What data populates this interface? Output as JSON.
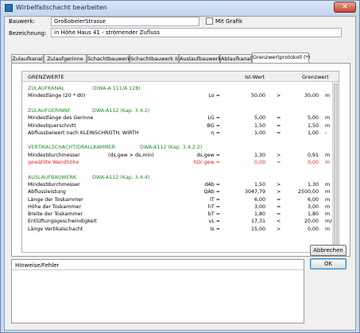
{
  "window": {
    "title": "Wirbelfallschacht bearbeiten",
    "close_glyph": "✕"
  },
  "form": {
    "bauwerk_label": "Bauwerk:",
    "bauwerk_value": "GroßobelerStrasse",
    "mit_grafik_label": "Mit Grafik",
    "bezeichnung_label": "Bezeichnung:",
    "bezeichnung_value": "in Höhe Haus 41 - strömender Zufluss"
  },
  "tabs": [
    "Zulaufkanal",
    "Zulaufgerinne",
    "Schachtbauwerk I",
    "Schachtbauwerk II",
    "Auslaufbauwerk",
    "Ablaufkanal",
    "Grenzwertprotokoll (*)"
  ],
  "grid": {
    "headers": {
      "name": "GRENZWERTE",
      "ist": "Ist-Wert",
      "grenz": "Grenzwert"
    },
    "rows": [
      {
        "type": "section",
        "name": "ZULAUFKANAL",
        "ref": "(DWA-A 111/A 128)"
      },
      {
        "type": "data",
        "name": "Mindestlänge (20 * d0)",
        "sym": "Lo =",
        "val": "50,00",
        "op": ">",
        "limit": "30,00",
        "unit": "m"
      },
      {
        "type": "blank"
      },
      {
        "type": "section",
        "name": "ZULAUFGERINNE",
        "ref": "DWA-A112 (Kap. 3.4.2)"
      },
      {
        "type": "data",
        "name": "Mindestlänge  des Gerinne",
        "sym": "LG =",
        "val": "5,00",
        "op": "=",
        "limit": "5,00",
        "unit": "m"
      },
      {
        "type": "data",
        "name": "Mindestquerschnitt",
        "sym": "BG =",
        "val": "1,50",
        "op": "=",
        "limit": "1,50",
        "unit": "m"
      },
      {
        "type": "data",
        "name": "Abflussbeiwert nach KLEINSCHROTH, WIRTH",
        "sym": "η =",
        "val": "1,00",
        "op": "=",
        "limit": "1,00",
        "unit": "-"
      },
      {
        "type": "blank"
      },
      {
        "type": "section",
        "name": "VERTIKALSCHACHT/DRALLKAMMER",
        "ref": "DWA-A112 (Kap. 3.4.2.2)"
      },
      {
        "type": "data",
        "name": "Mindestdurchmesser",
        "mid": "(ds,gew > ds,min)",
        "sym": "ds,gew =",
        "val": "1,30",
        "op": ">",
        "limit": "0,91",
        "unit": "m"
      },
      {
        "type": "red",
        "name": "gewählte Wandhöhe",
        "sym": "hDr,gew =",
        "val": "0,00",
        "op": "=",
        "limit": "0,00",
        "unit": "m"
      },
      {
        "type": "blank"
      },
      {
        "type": "section",
        "name": "AUSLAUFBAUWERK",
        "ref": "DWA-A112 (Kap. 3.4.4)"
      },
      {
        "type": "data",
        "name": "Mindestdurchmesser",
        "sym": "dAb =",
        "val": "1,50",
        "op": ">",
        "limit": "1,30",
        "unit": "m"
      },
      {
        "type": "data",
        "name": "Abflussleistung",
        "sym": "QAb =",
        "val": "3047,79",
        "op": ">",
        "limit": "2500,00",
        "unit": "m"
      },
      {
        "type": "data",
        "name": "Länge der Toskammer",
        "sym": "lT =",
        "val": "6,00",
        "op": "=",
        "limit": "6,00",
        "unit": "m"
      },
      {
        "type": "data",
        "name": "Höhe der Toskammer",
        "sym": "hT =",
        "val": "3,00",
        "op": "=",
        "limit": "3,00",
        "unit": "m"
      },
      {
        "type": "data",
        "name": "Breite der Toskammer",
        "sym": "bT =",
        "val": "1,80",
        "op": "=",
        "limit": "1,80",
        "unit": "m"
      },
      {
        "type": "data",
        "name": "Entlüftungsgeschwindigkeit",
        "sym": "vL =",
        "val": "17,31",
        "op": "<",
        "limit": "20,00",
        "unit": "m/s"
      },
      {
        "type": "data",
        "name": "Länge Vertikalschacht",
        "sym": "ls =",
        "val": "15,00",
        "op": ">",
        "limit": "0,00",
        "unit": "m"
      }
    ]
  },
  "hints": {
    "label": "Hinweise/Fehler"
  },
  "buttons": {
    "abbrechen": "Abbrechen",
    "ok": "OK"
  }
}
